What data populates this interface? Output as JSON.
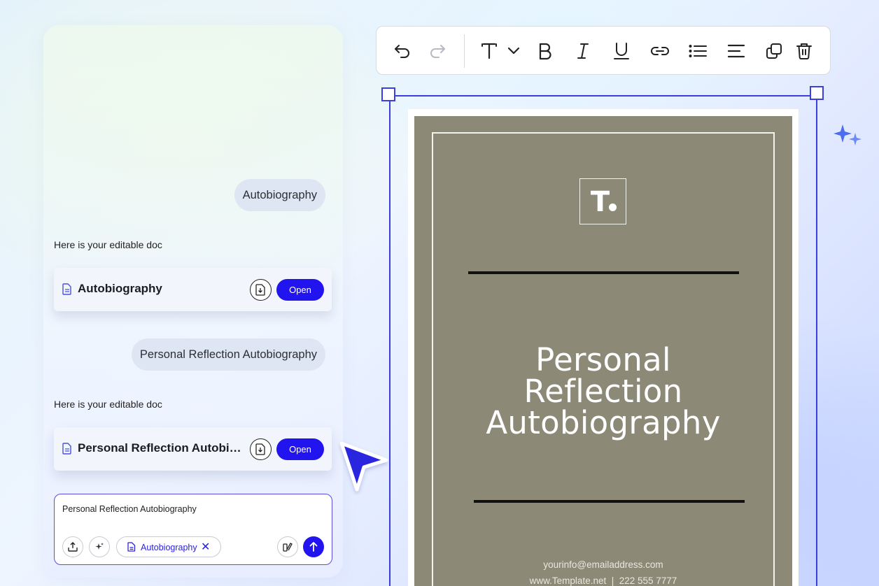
{
  "chat": {
    "messages": [
      {
        "role": "user",
        "text": "Autobiography"
      },
      {
        "role": "assistant",
        "text": "Here is your editable doc",
        "doc": {
          "title": "Autobiography",
          "open_label": "Open"
        }
      },
      {
        "role": "user",
        "text": "Personal Reflection Autobiography"
      },
      {
        "role": "assistant",
        "text": "Here is your editable doc",
        "doc": {
          "title": "Personal Reflection Autobiography",
          "open_label": "Open"
        }
      }
    ],
    "composer": {
      "value": "Personal Reflection Autobiography",
      "attachment_chip": "Autobiography",
      "chip_remove": "✕"
    }
  },
  "toolbar": {
    "buttons": [
      "undo",
      "redo",
      "text-style",
      "bold",
      "italic",
      "underline",
      "link",
      "bulleted-list",
      "align",
      "duplicate",
      "delete"
    ]
  },
  "document": {
    "logo_text": "T",
    "title_lines": [
      "Personal",
      "Reflection",
      "Autobiography"
    ],
    "email": "yourinfo@emailaddress.com",
    "website_phone": "www.Template.net  |  222 555 7777"
  },
  "colors": {
    "accent": "#2114ee",
    "selection": "#3b3ee0",
    "page_background": "#8c8a77"
  }
}
